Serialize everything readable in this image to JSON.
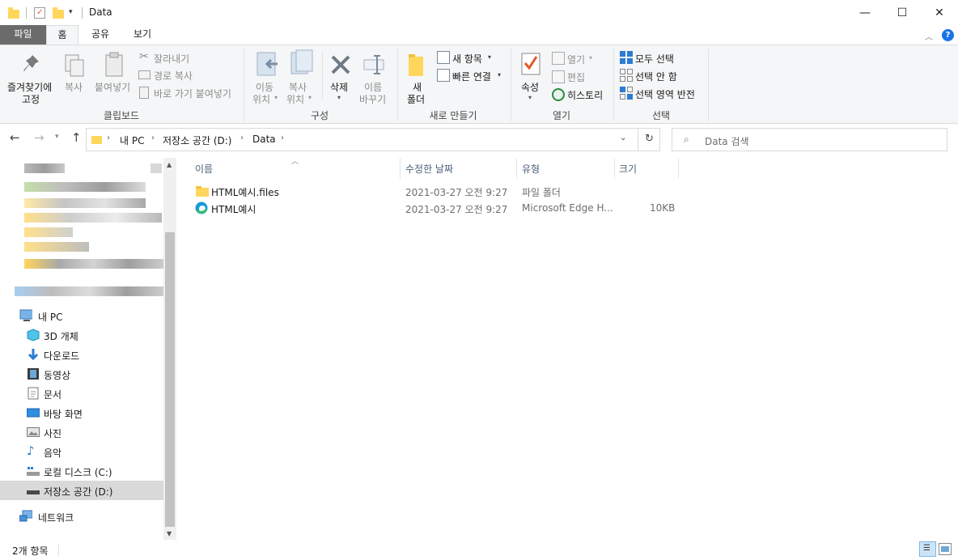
{
  "window": {
    "title": "Data",
    "controls": {
      "minimize": "—",
      "maximize": "☐",
      "close": "✕"
    }
  },
  "ribbon_tabs": [
    "파일",
    "홈",
    "공유",
    "보기"
  ],
  "ribbon": {
    "clipboard": {
      "pin_label_1": "즐겨찾기에",
      "pin_label_2": "고정",
      "copy": "복사",
      "paste": "붙여넣기",
      "cut": "잘라내기",
      "copy_path": "경로 복사",
      "paste_shortcut": "바로 가기 붙여넣기",
      "group": "클립보드"
    },
    "organize": {
      "move_to_1": "이동",
      "move_to_2": "위치",
      "copy_to_1": "복사",
      "copy_to_2": "위치",
      "delete": "삭제",
      "rename_1": "이름",
      "rename_2": "바꾸기",
      "group": "구성"
    },
    "new": {
      "new_folder_1": "새",
      "new_folder_2": "폴더",
      "new_item": "새 항목",
      "easy_access": "빠른 연결",
      "group": "새로 만들기"
    },
    "open": {
      "properties": "속성",
      "open": "열기",
      "edit": "편집",
      "history": "히스토리",
      "group": "열기"
    },
    "select": {
      "select_all": "모두 선택",
      "select_none": "선택 안 함",
      "invert": "선택 영역 반전",
      "group": "선택"
    }
  },
  "address": {
    "breadcrumb": [
      "내 PC",
      "저장소 공간 (D:)",
      "Data"
    ],
    "search_placeholder": "Data 검색"
  },
  "navpane": {
    "this_pc": "내 PC",
    "items": [
      {
        "label": "3D 개체",
        "icon": "3d-objects-icon"
      },
      {
        "label": "다운로드",
        "icon": "download-icon"
      },
      {
        "label": "동영상",
        "icon": "video-icon"
      },
      {
        "label": "문서",
        "icon": "document-icon"
      },
      {
        "label": "바탕 화면",
        "icon": "desktop-icon"
      },
      {
        "label": "사진",
        "icon": "pictures-icon"
      },
      {
        "label": "음악",
        "icon": "music-icon"
      },
      {
        "label": "로컬 디스크 (C:)",
        "icon": "disk-icon"
      },
      {
        "label": "저장소 공간 (D:)",
        "icon": "drive-icon"
      }
    ],
    "network": "네트워크"
  },
  "columns": [
    "이름",
    "수정한 날짜",
    "유형",
    "크기"
  ],
  "files": [
    {
      "name": "HTML예시.files",
      "date": "2021-03-27 오전 9:27",
      "type": "파일 폴더",
      "size": "",
      "icon": "folder-icon"
    },
    {
      "name": "HTML예시",
      "date": "2021-03-27 오전 9:27",
      "type": "Microsoft Edge H...",
      "size": "10KB",
      "icon": "edge-icon"
    }
  ],
  "status": {
    "count": "2개 항목"
  },
  "colors": {
    "accent": "#1a73e8",
    "folder": "#ffd65c",
    "selected": "#d9d9d9"
  }
}
